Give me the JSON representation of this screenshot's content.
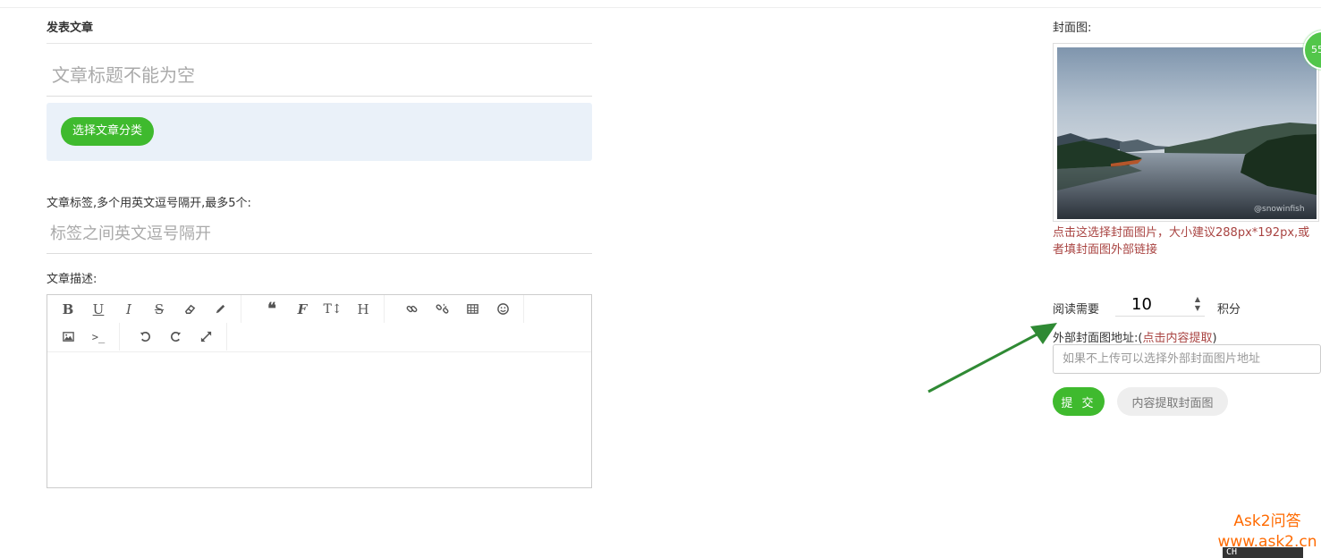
{
  "page": {
    "heading": "发表文章",
    "title_placeholder": "文章标题不能为空",
    "category_button": "选择文章分类",
    "tags_label": "文章标签,多个用英文逗号隔开,最多5个:",
    "tags_placeholder": "标签之间英文逗号隔开",
    "desc_label": "文章描述:"
  },
  "editor": {
    "toolbar": [
      {
        "name": "bold-icon",
        "glyph": "B"
      },
      {
        "name": "underline-icon",
        "glyph": "U"
      },
      {
        "name": "italic-icon",
        "glyph": "I"
      },
      {
        "name": "strikethrough-icon",
        "glyph": "S"
      },
      {
        "name": "eraser-icon",
        "glyph": "eraser"
      },
      {
        "name": "pencil-icon",
        "glyph": "pencil"
      },
      {
        "name": "quote-icon",
        "glyph": "quote"
      },
      {
        "name": "font-icon",
        "glyph": "F"
      },
      {
        "name": "text-height-icon",
        "glyph": "TI"
      },
      {
        "name": "header-icon",
        "glyph": "H"
      },
      {
        "name": "link-icon",
        "glyph": "link"
      },
      {
        "name": "unlink-icon",
        "glyph": "unlink"
      },
      {
        "name": "table-icon",
        "glyph": "table"
      },
      {
        "name": "emoji-icon",
        "glyph": "smile"
      },
      {
        "name": "image-icon",
        "glyph": "image"
      },
      {
        "name": "code-icon",
        "glyph": "code"
      },
      {
        "name": "undo-icon",
        "glyph": "undo"
      },
      {
        "name": "redo-icon",
        "glyph": "redo"
      },
      {
        "name": "fullscreen-icon",
        "glyph": "expand"
      }
    ]
  },
  "sidebar": {
    "cover_label": "封面图:",
    "badge_text": "55",
    "photo_watermark": "@snowinfish",
    "cover_hint": "点击这选择封面图片，大小建议288px*192px,或者填封面图外部链接",
    "read_label": "阅读需要",
    "read_value": "10",
    "points_label": "积分",
    "ext_label": "外部封面图地址:(",
    "ext_link": "点击内容提取",
    "ext_label_end": ")",
    "ext_placeholder": "如果不上传可以选择外部封面图片地址",
    "submit": "提 交",
    "extract": "内容提取封面图"
  },
  "watermark": {
    "line1": "Ask2问答",
    "line2": "www.ask2.cn"
  },
  "ime": {
    "text": "CH"
  },
  "colors": {
    "accent": "#3fba2e",
    "hint": "#a94442",
    "watermark": "#ff6a00",
    "arrow": "#2f8a34"
  }
}
